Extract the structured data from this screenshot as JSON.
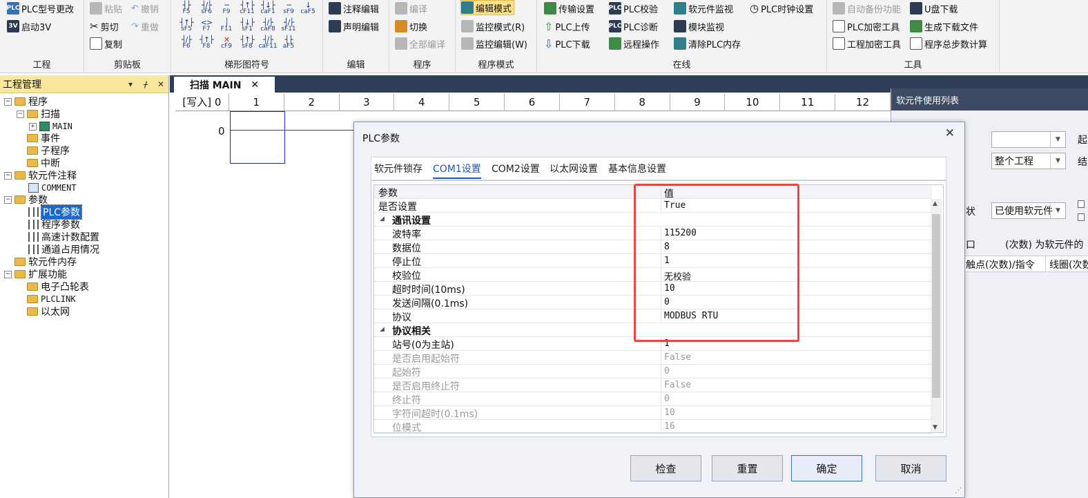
{
  "ribbon": {
    "groups": {
      "project": "工程",
      "clipboard": "剪贴板",
      "ladder": "梯形图符号",
      "edit": "编辑",
      "program": "程序",
      "program_mode": "程序模式",
      "online": "在线",
      "tools": "工具"
    },
    "project": {
      "change_model": "PLC型号更改",
      "start_3v": "启动3V"
    },
    "clipboard": {
      "paste": "粘贴",
      "undo": "撤销",
      "cut": "剪切",
      "redo": "重做",
      "copy": "复制"
    },
    "ladder_symbols": [
      [
        "F5",
        "sF6",
        "F9",
        "cF11",
        "caF1",
        "sF9",
        "caF5"
      ],
      [
        "sF5",
        "F7",
        "F11",
        "sF1",
        "caF8",
        "sF11"
      ],
      [
        "F6",
        "F8",
        "cF9",
        "sF8",
        "caF11",
        "aF5"
      ]
    ],
    "edit": {
      "comment_edit": "注释编辑",
      "declare_edit": "声明编辑"
    },
    "program": {
      "compile": "编译",
      "switch": "切换",
      "compile_all": "全部编译"
    },
    "program_mode": {
      "edit_mode": "编辑模式",
      "monitor_mode": "监控模式(R)",
      "monitor_edit": "监控编辑(W)"
    },
    "online": {
      "transfer_settings": "传输设置",
      "plc_upload": "PLC上传",
      "plc_download": "PLC下载",
      "plc_verify": "PLC校验",
      "plc_diagnose": "PLC诊断",
      "remote_op": "远程操作",
      "device_monitor": "软元件监视",
      "module_monitor": "模块监视",
      "clear_memory": "清除PLC内存",
      "plc_clock": "PLC时钟设置"
    },
    "tools": {
      "auto_backup": "自动备份功能",
      "usb_download": "U盘下载",
      "plc_encrypt": "PLC加密工具",
      "gen_download_file": "生成下载文件",
      "project_encrypt": "工程加密工具",
      "step_calc": "程序总步数计算"
    }
  },
  "left_panel": {
    "title": "工程管理",
    "pin": "▾",
    "dock": "ᚋ",
    "close": "✕",
    "tree": {
      "program": "程序",
      "scan": "扫描",
      "main": "MAIN",
      "event": "事件",
      "subprogram": "子程序",
      "interrupt": "中断",
      "device_comment": "软元件注释",
      "comment": "COMMENT",
      "params": "参数",
      "plc_params": "PLC参数",
      "program_params": "程序参数",
      "hs_counter": "高速计数配置",
      "channel_usage": "通道占用情况",
      "device_memory": "软元件内存",
      "extensions": "扩展功能",
      "cam_table": "电子凸轮表",
      "plclink": "PLCLINK",
      "ethernet": "以太网"
    }
  },
  "editor": {
    "tab_label": "扫描 MAIN",
    "tab_close": "✕",
    "columns": [
      "[写入] 0",
      "1",
      "2",
      "3",
      "4",
      "5",
      "6",
      "7",
      "8",
      "9",
      "10",
      "11",
      "12"
    ],
    "rung_number": "0"
  },
  "right_panel": {
    "title": "软元件使用列表",
    "scope_value": "整个工程",
    "label_start": "起",
    "label_end": "结",
    "status_label": "状",
    "status_value": "已使用软元件",
    "note_prefix": "口",
    "note": "(次数) 为软元件的",
    "col_contact": "触点(次数)/指令",
    "col_coil": "线圈(次数"
  },
  "dialog": {
    "title": "PLC参数",
    "close": "✕",
    "tabs": [
      "软元件锁存",
      "COM1设置",
      "COM2设置",
      "以太网设置",
      "基本信息设置"
    ],
    "active_tab": 1,
    "header": {
      "param": "参数",
      "value": "值"
    },
    "rows": [
      {
        "key": "是否设置",
        "value": "True",
        "kind": "top"
      },
      {
        "key": "通讯设置",
        "value": "",
        "kind": "cat"
      },
      {
        "key": "波特率",
        "value": "115200",
        "kind": "item"
      },
      {
        "key": "数据位",
        "value": "8",
        "kind": "item"
      },
      {
        "key": "停止位",
        "value": "1",
        "kind": "item"
      },
      {
        "key": "校验位",
        "value": "无校验",
        "kind": "item"
      },
      {
        "key": "超时时间(10ms)",
        "value": "10",
        "kind": "item"
      },
      {
        "key": "发送间隔(0.1ms)",
        "value": "0",
        "kind": "item"
      },
      {
        "key": "协议",
        "value": "MODBUS RTU",
        "kind": "item"
      },
      {
        "key": "协议相关",
        "value": "",
        "kind": "cat"
      },
      {
        "key": "站号(0为主站)",
        "value": "1",
        "kind": "item"
      },
      {
        "key": "是否启用起始符",
        "value": "False",
        "kind": "dis"
      },
      {
        "key": "起始符",
        "value": "0",
        "kind": "dis"
      },
      {
        "key": "是否启用终止符",
        "value": "False",
        "kind": "dis"
      },
      {
        "key": "终止符",
        "value": "0",
        "kind": "dis"
      },
      {
        "key": "字符间超时(0.1ms)",
        "value": "10",
        "kind": "dis"
      },
      {
        "key": "位模式",
        "value": "16",
        "kind": "dis"
      }
    ],
    "buttons": {
      "check": "检查",
      "reset": "重置",
      "ok": "确定",
      "cancel": "取消"
    }
  },
  "colors": {
    "highlight_box": "#e8473f",
    "accent_blue": "#1858c8",
    "panel_dark": "#2f3f5a"
  }
}
